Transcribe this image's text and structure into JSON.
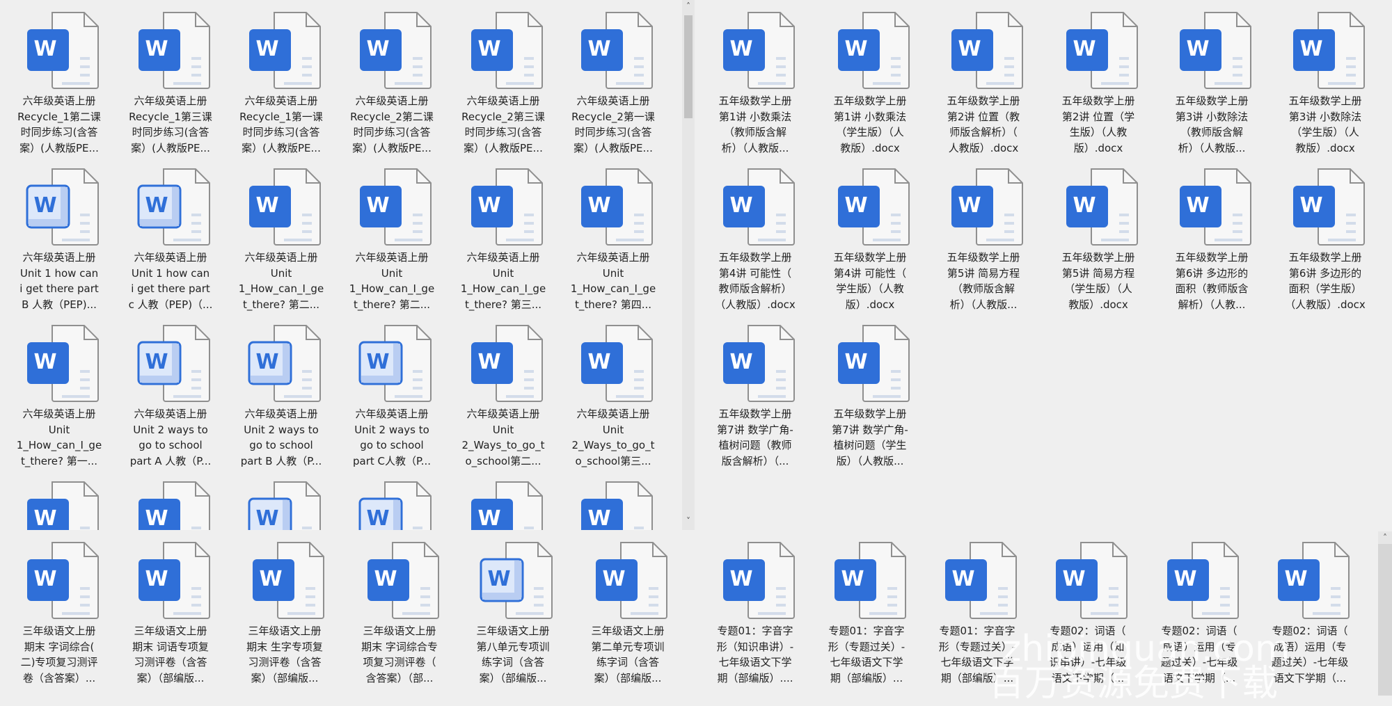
{
  "colors": {
    "word_blue": "#2f6fd8",
    "word_light_fill": "#dde8fa",
    "doc_stroke": "#8f8f8f",
    "background": "#efefef"
  },
  "panels": {
    "top_left": {
      "files": [
        {
          "lines": [
            "六年级英语上册",
            "Recycle_1第二课",
            "时同步练习(含答",
            "案）(人教版PE..."
          ],
          "icon": "solid"
        },
        {
          "lines": [
            "六年级英语上册",
            "Recycle_1第三课",
            "时同步练习(含答",
            "案）(人教版PE..."
          ],
          "icon": "solid"
        },
        {
          "lines": [
            "六年级英语上册",
            "Recycle_1第一课",
            "时同步练习(含答",
            "案）(人教版PE..."
          ],
          "icon": "solid"
        },
        {
          "lines": [
            "六年级英语上册",
            "Recycle_2第二课",
            "时同步练习(含答",
            "案）(人教版PE..."
          ],
          "icon": "solid"
        },
        {
          "lines": [
            "六年级英语上册",
            "Recycle_2第三课",
            "时同步练习(含答",
            "案）(人教版PE..."
          ],
          "icon": "solid"
        },
        {
          "lines": [
            "六年级英语上册",
            "Recycle_2第一课",
            "时同步练习(含答",
            "案）(人教版PE..."
          ],
          "icon": "solid"
        },
        {
          "lines": [
            "六年级英语上册",
            "Unit 1 how can",
            "i get there part",
            "B 人教（PEP)..."
          ],
          "icon": "light"
        },
        {
          "lines": [
            "六年级英语上册",
            "Unit 1 how can",
            "i get there part",
            "c 人教（PEP)（..."
          ],
          "icon": "light"
        },
        {
          "lines": [
            "六年级英语上册",
            "Unit",
            "1_How_can_I_ge",
            "t_there? 第二..."
          ],
          "icon": "solid"
        },
        {
          "lines": [
            "六年级英语上册",
            "Unit",
            "1_How_can_I_ge",
            "t_there? 第二..."
          ],
          "icon": "solid"
        },
        {
          "lines": [
            "六年级英语上册",
            "Unit",
            "1_How_can_I_ge",
            "t_there? 第三..."
          ],
          "icon": "solid"
        },
        {
          "lines": [
            "六年级英语上册",
            "Unit",
            "1_How_can_I_ge",
            "t_there? 第四..."
          ],
          "icon": "solid"
        },
        {
          "lines": [
            "六年级英语上册",
            "Unit",
            "1_How_can_I_ge",
            "t_there? 第一..."
          ],
          "icon": "solid"
        },
        {
          "lines": [
            "六年级英语上册",
            "Unit 2 ways to",
            "go to school",
            "part A 人教（P..."
          ],
          "icon": "light"
        },
        {
          "lines": [
            "六年级英语上册",
            "Unit 2 ways to",
            "go to school",
            "part B 人教（P..."
          ],
          "icon": "light"
        },
        {
          "lines": [
            "六年级英语上册",
            "Unit 2 ways to",
            "go to school",
            "part C人教（P..."
          ],
          "icon": "light"
        },
        {
          "lines": [
            "六年级英语上册",
            "Unit",
            "2_Ways_to_go_t",
            "o_school第二..."
          ],
          "icon": "solid"
        },
        {
          "lines": [
            "六年级英语上册",
            "Unit",
            "2_Ways_to_go_t",
            "o_school第三..."
          ],
          "icon": "solid"
        },
        {
          "lines": [],
          "icon": "solid"
        },
        {
          "lines": [],
          "icon": "solid"
        },
        {
          "lines": [],
          "icon": "light"
        },
        {
          "lines": [],
          "icon": "light"
        },
        {
          "lines": [],
          "icon": "solid"
        },
        {
          "lines": [],
          "icon": "solid"
        }
      ]
    },
    "top_right": {
      "files": [
        {
          "lines": [
            "五年级数学上册",
            "第1讲 小数乘法",
            "（教师版含解",
            "析）（人教版..."
          ],
          "icon": "solid"
        },
        {
          "lines": [
            "五年级数学上册",
            "第1讲 小数乘法",
            "（学生版）（人",
            "教版）.docx"
          ],
          "icon": "solid"
        },
        {
          "lines": [
            "五年级数学上册",
            "第2讲 位置（教",
            "师版含解析）（",
            "人教版）.docx"
          ],
          "icon": "solid"
        },
        {
          "lines": [
            "五年级数学上册",
            "第2讲 位置（学",
            "生版）（人教",
            "版）.docx"
          ],
          "icon": "solid"
        },
        {
          "lines": [
            "五年级数学上册",
            "第3讲 小数除法",
            "（教师版含解",
            "析）（人教版..."
          ],
          "icon": "solid"
        },
        {
          "lines": [
            "五年级数学上册",
            "第3讲 小数除法",
            "（学生版）（人",
            "教版）.docx"
          ],
          "icon": "solid"
        },
        {
          "lines": [
            "五年级数学上册",
            "第4讲 可能性（",
            "教师版含解析）",
            "（人教版）.docx"
          ],
          "icon": "solid"
        },
        {
          "lines": [
            "五年级数学上册",
            "第4讲 可能性（",
            "学生版）（人教",
            "版）.docx"
          ],
          "icon": "solid"
        },
        {
          "lines": [
            "五年级数学上册",
            "第5讲 简易方程",
            "（教师版含解",
            "析）（人教版..."
          ],
          "icon": "solid"
        },
        {
          "lines": [
            "五年级数学上册",
            "第5讲 简易方程",
            "（学生版）（人",
            "教版）.docx"
          ],
          "icon": "solid"
        },
        {
          "lines": [
            "五年级数学上册",
            "第6讲 多边形的",
            "面积（教师版含",
            "解析）（人教..."
          ],
          "icon": "solid"
        },
        {
          "lines": [
            "五年级数学上册",
            "第6讲 多边形的",
            "面积（学生版）",
            "（人教版）.docx"
          ],
          "icon": "solid"
        },
        {
          "lines": [
            "五年级数学上册",
            "第7讲 数学广角-",
            "植树问题（教师",
            "版含解析）（..."
          ],
          "icon": "solid"
        },
        {
          "lines": [
            "五年级数学上册",
            "第7讲 数学广角-",
            "植树问题（学生",
            "版）（人教版..."
          ],
          "icon": "solid"
        }
      ]
    },
    "bottom_left": {
      "files": [
        {
          "lines": [
            "三年级语文上册",
            "期末  字词综合(",
            "二)专项复习测评",
            "卷（含答案）..."
          ],
          "icon": "solid"
        },
        {
          "lines": [
            "三年级语文上册",
            "期末 词语专项复",
            "习测评卷（含答",
            "案）（部编版..."
          ],
          "icon": "solid"
        },
        {
          "lines": [
            "三年级语文上册",
            "期末 生字专项复",
            "习测评卷（含答",
            "案）（部编版..."
          ],
          "icon": "solid"
        },
        {
          "lines": [
            "三年级语文上册",
            "期末 字词综合专",
            "项复习测评卷（",
            "含答案）（部..."
          ],
          "icon": "solid"
        },
        {
          "lines": [
            "三年级语文上册",
            "第八单元专项训",
            "练字词（含答",
            "案）（部编版..."
          ],
          "icon": "light"
        },
        {
          "lines": [
            "三年级语文上册",
            "第二单元专项训",
            "练字词（含答",
            "案）（部编版..."
          ],
          "icon": "solid"
        }
      ]
    },
    "bottom_right": {
      "files": [
        {
          "lines": [
            "专题01：字音字",
            "形（知识串讲）-",
            "七年级语文下学",
            "期（部编版）...."
          ],
          "icon": "solid"
        },
        {
          "lines": [
            "专题01：字音字",
            "形（专题过关）-",
            "七年级语文下学",
            "期（部编版）..."
          ],
          "icon": "solid"
        },
        {
          "lines": [
            "专题01：字音字",
            "形（专题过关）-",
            "七年级语文下学",
            "期（部编版）..."
          ],
          "icon": "solid"
        },
        {
          "lines": [
            "专题02：词语（",
            "成语）运用（知",
            "识串讲）-七年级",
            "语文下学期（..."
          ],
          "icon": "solid"
        },
        {
          "lines": [
            "专题02：词语（",
            "成语）运用（专",
            "题过关）-七年级",
            "语文下学期（..."
          ],
          "icon": "solid"
        },
        {
          "lines": [
            "专题02：词语（",
            "成语）运用（专",
            "题过关）-七年级",
            "语文下学期（..."
          ],
          "icon": "solid"
        }
      ]
    }
  },
  "scroll": {
    "up_glyph": "˄",
    "down_glyph": "˅"
  },
  "watermark": {
    "line1": "zhipinquan.com",
    "line2": "百万资源免费下载"
  }
}
